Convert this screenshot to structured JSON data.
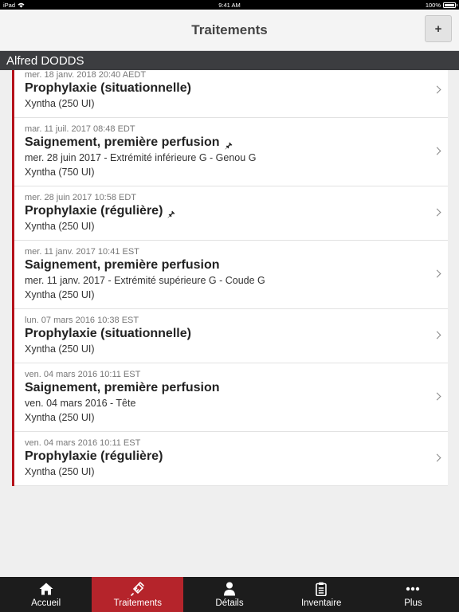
{
  "status_bar": {
    "device": "iPad",
    "time": "9:41 AM",
    "battery": "100%",
    "battery_level": 1.0
  },
  "header": {
    "title": "Traitements",
    "add_label": "+"
  },
  "patient": {
    "name": "Alfred DODDS"
  },
  "treatments": [
    {
      "date": "mer. 18 janv. 2018 20:40 AEDT",
      "title": "Prophylaxie (situationnelle)",
      "pinned": false,
      "details": [],
      "product": "Xyntha (250 UI)"
    },
    {
      "date": "mar. 11 juil. 2017 08:48 EDT",
      "title": "Saignement, première perfusion",
      "pinned": true,
      "details": [
        "mer. 28 juin 2017 - Extrémité inférieure G - Genou G"
      ],
      "product": "Xyntha (750 UI)"
    },
    {
      "date": "mer. 28 juin 2017 10:58 EDT",
      "title": "Prophylaxie (régulière)",
      "pinned": true,
      "details": [],
      "product": "Xyntha (250 UI)"
    },
    {
      "date": "mer. 11 janv. 2017 10:41 EST",
      "title": "Saignement, première perfusion",
      "pinned": false,
      "details": [
        "mer. 11 janv. 2017 - Extrémité supérieure G - Coude G"
      ],
      "product": "Xyntha (250 UI)"
    },
    {
      "date": "lun. 07 mars 2016 10:38 EST",
      "title": "Prophylaxie (situationnelle)",
      "pinned": false,
      "details": [],
      "product": "Xyntha (250 UI)"
    },
    {
      "date": "ven. 04 mars 2016 10:11 EST",
      "title": "Saignement, première perfusion",
      "pinned": false,
      "details": [
        "ven. 04 mars 2016 - Tête"
      ],
      "product": "Xyntha (250 UI)"
    },
    {
      "date": "ven. 04 mars 2016 10:11 EST",
      "title": "Prophylaxie (régulière)",
      "pinned": false,
      "details": [],
      "product": "Xyntha (250 UI)"
    }
  ],
  "tabs": [
    {
      "label": "Accueil",
      "icon": "home-icon",
      "active": false
    },
    {
      "label": "Traitements",
      "icon": "syringe-icon",
      "active": true
    },
    {
      "label": "Détails",
      "icon": "person-icon",
      "active": false
    },
    {
      "label": "Inventaire",
      "icon": "clipboard-icon",
      "active": false
    },
    {
      "label": "Plus",
      "icon": "more-icon",
      "active": false
    }
  ],
  "colors": {
    "accent": "#b5121b",
    "active_tab": "#b5242b",
    "tab_bar": "#1c1c1c",
    "patient_bar": "#3c3d40"
  }
}
